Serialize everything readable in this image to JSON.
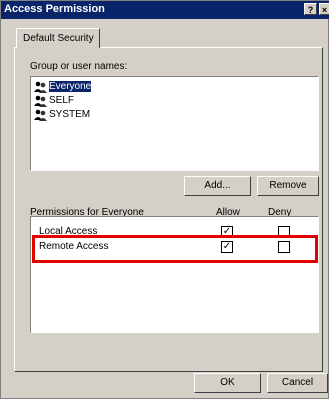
{
  "window": {
    "title": "Access Permission",
    "help_glyph": "?",
    "close_glyph": "×"
  },
  "tab": {
    "label": "Default Security"
  },
  "groups": {
    "label": "Group or user names:",
    "items": [
      {
        "name": "Everyone",
        "icon": "users-icon",
        "selected": true
      },
      {
        "name": "SELF",
        "icon": "users-icon",
        "selected": false
      },
      {
        "name": "SYSTEM",
        "icon": "users-icon",
        "selected": false
      }
    ]
  },
  "buttons": {
    "add": "Add...",
    "remove": "Remove",
    "ok": "OK",
    "cancel": "Cancel"
  },
  "permissions": {
    "label": "Permissions for Everyone",
    "allow_header": "Allow",
    "deny_header": "Deny",
    "rows": [
      {
        "name": "Local Access",
        "allow": true,
        "deny": false
      },
      {
        "name": "Remote Access",
        "allow": true,
        "deny": false
      }
    ]
  },
  "check_glyph": "✓",
  "colors": {
    "titlebar": "#0a246a",
    "highlight": "#e00000",
    "face": "#d4d0c8"
  }
}
